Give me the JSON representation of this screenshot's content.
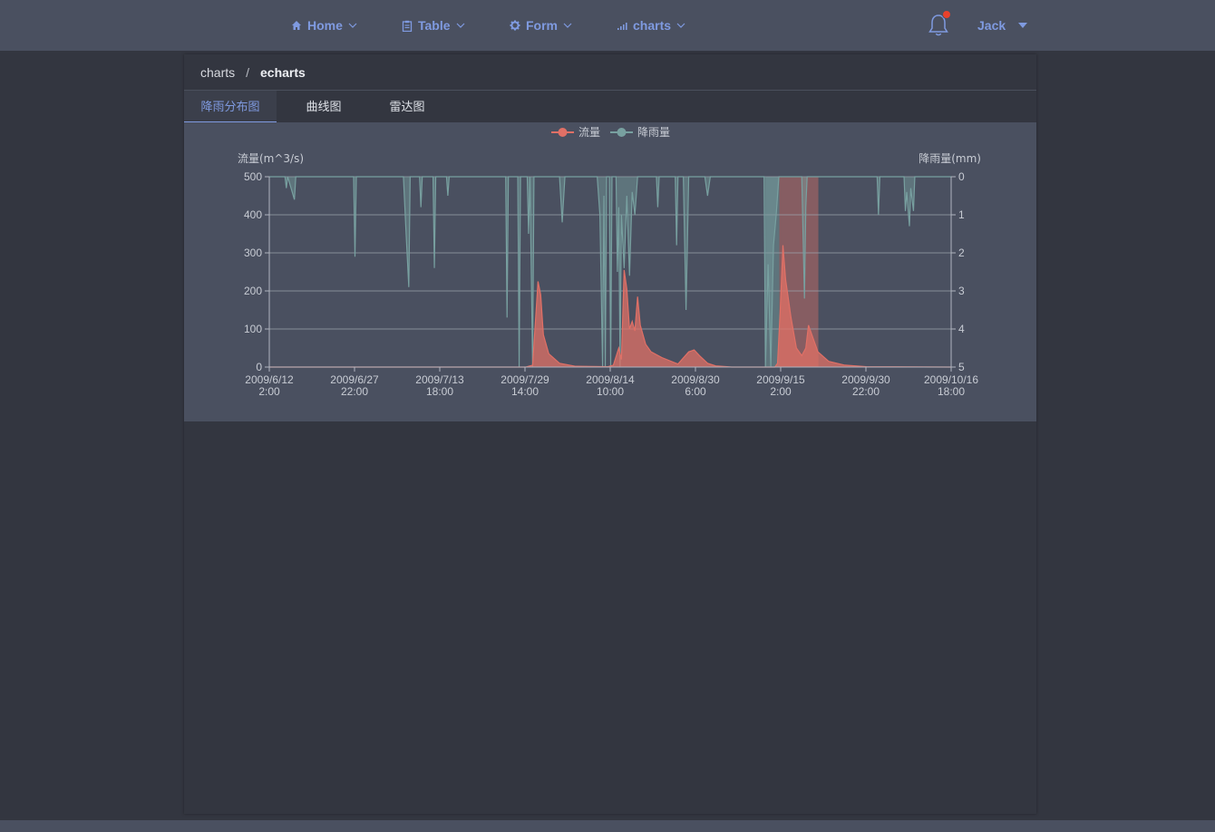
{
  "nav": {
    "items": [
      {
        "label": "Home",
        "icon": "home-icon"
      },
      {
        "label": "Table",
        "icon": "clipboard-icon"
      },
      {
        "label": "Form",
        "icon": "gear-icon"
      },
      {
        "label": "charts",
        "icon": "bar-chart-icon"
      }
    ],
    "user": "Jack",
    "notification_indicator": true
  },
  "breadcrumb": {
    "items": [
      "charts",
      "echarts"
    ],
    "separator": "/"
  },
  "tabs": [
    {
      "label": "降雨分布图",
      "active": true
    },
    {
      "label": "曲线图",
      "active": false
    },
    {
      "label": "雷达图",
      "active": false
    }
  ],
  "colors": {
    "accent": "#7f9ae0",
    "flow": "#e07066",
    "rain": "#78a0a0",
    "panel_bg": "#4a5060",
    "page_bg": "#333640"
  },
  "chart_data": {
    "type": "area",
    "legend": [
      "流量",
      "降雨量"
    ],
    "legend_position": "top-center",
    "y_left": {
      "label": "流量(m^3/s)",
      "min": 0,
      "max": 500,
      "ticks": [
        0,
        100,
        200,
        300,
        400,
        500
      ]
    },
    "y_right": {
      "label": "降雨量(mm)",
      "min": 0,
      "max": 5,
      "inverse": true,
      "ticks": [
        0,
        1,
        2,
        3,
        4,
        5
      ]
    },
    "x_axis": {
      "type": "time",
      "start": "2009-06-12 02:00",
      "end": "2009-10-16 18:00",
      "tick_labels": [
        [
          "2009/6/12",
          "2:00"
        ],
        [
          "2009/6/27",
          "22:00"
        ],
        [
          "2009/7/13",
          "18:00"
        ],
        [
          "2009/7/29",
          "14:00"
        ],
        [
          "2009/8/14",
          "10:00"
        ],
        [
          "2009/8/30",
          "6:00"
        ],
        [
          "2009/9/15",
          "2:00"
        ],
        [
          "2009/9/30",
          "22:00"
        ],
        [
          "2009/10/16",
          "18:00"
        ]
      ]
    },
    "grid": true,
    "mark_areas": [
      {
        "series": "降雨量",
        "from": "2009-09-12 06:00",
        "to": "2009-09-14 20:00"
      },
      {
        "series": "流量",
        "from": "2009-09-14 20:00",
        "to": "2009-09-22 02:00"
      }
    ],
    "series": [
      {
        "name": "流量",
        "points": [
          [
            "2009-06-12 02:00",
            0
          ],
          [
            "2009-07-29 18:00",
            0
          ],
          [
            "2009-07-31 00:00",
            5
          ],
          [
            "2009-08-01 00:00",
            225
          ],
          [
            "2009-08-01 12:00",
            190
          ],
          [
            "2009-08-02 00:00",
            85
          ],
          [
            "2009-08-03 00:00",
            35
          ],
          [
            "2009-08-05 00:00",
            10
          ],
          [
            "2009-08-08 00:00",
            2
          ],
          [
            "2009-08-14 00:00",
            1
          ],
          [
            "2009-08-15 00:00",
            5
          ],
          [
            "2009-08-16 00:00",
            50
          ],
          [
            "2009-08-16 12:00",
            20
          ],
          [
            "2009-08-17 00:00",
            255
          ],
          [
            "2009-08-17 12:00",
            205
          ],
          [
            "2009-08-18 00:00",
            100
          ],
          [
            "2009-08-18 12:00",
            120
          ],
          [
            "2009-08-19 00:00",
            95
          ],
          [
            "2009-08-19 12:00",
            185
          ],
          [
            "2009-08-20 00:00",
            110
          ],
          [
            "2009-08-21 00:00",
            60
          ],
          [
            "2009-08-22 00:00",
            40
          ],
          [
            "2009-08-24 00:00",
            25
          ],
          [
            "2009-08-27 00:00",
            8
          ],
          [
            "2009-08-29 00:00",
            40
          ],
          [
            "2009-08-30 00:00",
            45
          ],
          [
            "2009-08-31 00:00",
            30
          ],
          [
            "2009-09-01 12:00",
            10
          ],
          [
            "2009-09-03 00:00",
            3
          ],
          [
            "2009-09-06 00:00",
            0
          ],
          [
            "2009-09-14 00:00",
            0
          ],
          [
            "2009-09-14 12:00",
            10
          ],
          [
            "2009-09-15 00:00",
            150
          ],
          [
            "2009-09-15 12:00",
            320
          ],
          [
            "2009-09-16 00:00",
            230
          ],
          [
            "2009-09-17 00:00",
            130
          ],
          [
            "2009-09-18 00:00",
            50
          ],
          [
            "2009-09-19 00:00",
            30
          ],
          [
            "2009-09-19 18:00",
            50
          ],
          [
            "2009-09-20 06:00",
            110
          ],
          [
            "2009-09-21 00:00",
            80
          ],
          [
            "2009-09-22 00:00",
            40
          ],
          [
            "2009-09-24 00:00",
            15
          ],
          [
            "2009-09-27 00:00",
            5
          ],
          [
            "2009-10-01 00:00",
            1
          ],
          [
            "2009-10-16 18:00",
            0
          ]
        ]
      },
      {
        "name": "降雨量",
        "points": [
          [
            "2009-06-12 02:00",
            0
          ],
          [
            "2009-06-15 00:00",
            0
          ],
          [
            "2009-06-15 06:00",
            0.3
          ],
          [
            "2009-06-15 12:00",
            0
          ],
          [
            "2009-06-16 18:00",
            0.6
          ],
          [
            "2009-06-17 00:00",
            0
          ],
          [
            "2009-06-27 18:00",
            0
          ],
          [
            "2009-06-28 00:00",
            2.1
          ],
          [
            "2009-06-28 06:00",
            0
          ],
          [
            "2009-07-07 00:00",
            0
          ],
          [
            "2009-07-07 12:00",
            1.5
          ],
          [
            "2009-07-08 00:00",
            2.9
          ],
          [
            "2009-07-08 06:00",
            0
          ],
          [
            "2009-07-10 00:00",
            0
          ],
          [
            "2009-07-10 06:00",
            0.8
          ],
          [
            "2009-07-10 12:00",
            0
          ],
          [
            "2009-07-12 12:00",
            0
          ],
          [
            "2009-07-12 18:00",
            2.4
          ],
          [
            "2009-07-13 00:00",
            0
          ],
          [
            "2009-07-15 00:00",
            0
          ],
          [
            "2009-07-15 06:00",
            0.5
          ],
          [
            "2009-07-15 12:00",
            0
          ],
          [
            "2009-07-26 00:00",
            0
          ],
          [
            "2009-07-26 06:00",
            3.7
          ],
          [
            "2009-07-26 12:00",
            0
          ],
          [
            "2009-07-28 06:00",
            0
          ],
          [
            "2009-07-28 12:00",
            5
          ],
          [
            "2009-07-28 18:00",
            0
          ],
          [
            "2009-07-30 00:00",
            0
          ],
          [
            "2009-07-30 06:00",
            1.5
          ],
          [
            "2009-07-30 12:00",
            0
          ],
          [
            "2009-07-31 00:00",
            5
          ],
          [
            "2009-07-31 06:00",
            0
          ],
          [
            "2009-08-05 00:00",
            0
          ],
          [
            "2009-08-05 12:00",
            1.2
          ],
          [
            "2009-08-06 00:00",
            0
          ],
          [
            "2009-08-12 00:00",
            0
          ],
          [
            "2009-08-12 12:00",
            1.0
          ],
          [
            "2009-08-13 00:00",
            5
          ],
          [
            "2009-08-13 06:00",
            0.5
          ],
          [
            "2009-08-13 12:00",
            5
          ],
          [
            "2009-08-13 18:00",
            0
          ],
          [
            "2009-08-14 06:00",
            0
          ],
          [
            "2009-08-14 12:00",
            5
          ],
          [
            "2009-08-14 18:00",
            0
          ],
          [
            "2009-08-15 12:00",
            0
          ],
          [
            "2009-08-15 18:00",
            2.5
          ],
          [
            "2009-08-16 00:00",
            0.8
          ],
          [
            "2009-08-16 06:00",
            5
          ],
          [
            "2009-08-16 12:00",
            1.0
          ],
          [
            "2009-08-17 00:00",
            2.4
          ],
          [
            "2009-08-17 12:00",
            0.5
          ],
          [
            "2009-08-18 00:00",
            2.6
          ],
          [
            "2009-08-18 12:00",
            0.4
          ],
          [
            "2009-08-19 00:00",
            1.0
          ],
          [
            "2009-08-19 12:00",
            0
          ],
          [
            "2009-08-23 00:00",
            0
          ],
          [
            "2009-08-23 06:00",
            0.8
          ],
          [
            "2009-08-23 12:00",
            0
          ],
          [
            "2009-08-26 12:00",
            0
          ],
          [
            "2009-08-26 18:00",
            1.8
          ],
          [
            "2009-08-27 00:00",
            0
          ],
          [
            "2009-08-28 00:00",
            0
          ],
          [
            "2009-08-28 12:00",
            3.5
          ],
          [
            "2009-08-29 00:00",
            0
          ],
          [
            "2009-09-01 00:00",
            0
          ],
          [
            "2009-09-01 12:00",
            0.5
          ],
          [
            "2009-09-02 00:00",
            0
          ],
          [
            "2009-09-12 00:00",
            0
          ],
          [
            "2009-09-12 06:00",
            5
          ],
          [
            "2009-09-12 18:00",
            2.3
          ],
          [
            "2009-09-13 06:00",
            5
          ],
          [
            "2009-09-13 18:00",
            1.8
          ],
          [
            "2009-09-14 06:00",
            1.0
          ],
          [
            "2009-09-14 18:00",
            0
          ],
          [
            "2009-09-19 00:00",
            0
          ],
          [
            "2009-09-19 12:00",
            3.2
          ],
          [
            "2009-09-19 18:00",
            0.8
          ],
          [
            "2009-09-20 00:00",
            0
          ],
          [
            "2009-10-03 00:00",
            0
          ],
          [
            "2009-10-03 06:00",
            1.0
          ],
          [
            "2009-10-03 12:00",
            0
          ],
          [
            "2009-10-08 00:00",
            0
          ],
          [
            "2009-10-08 06:00",
            0.9
          ],
          [
            "2009-10-08 12:00",
            0.4
          ],
          [
            "2009-10-09 00:00",
            1.3
          ],
          [
            "2009-10-09 06:00",
            0.3
          ],
          [
            "2009-10-09 18:00",
            0.9
          ],
          [
            "2009-10-10 00:00",
            0
          ],
          [
            "2009-10-16 18:00",
            0
          ]
        ]
      }
    ]
  }
}
